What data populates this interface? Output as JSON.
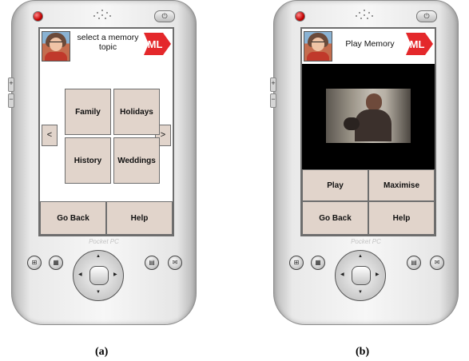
{
  "device_a": {
    "screen_title": "select a memory topic",
    "logo_text": "ML",
    "nav_prev": "<",
    "nav_next": ">",
    "topics": [
      "Family",
      "Holidays",
      "History",
      "Weddings"
    ],
    "buttons": {
      "go_back": "Go Back",
      "help": "Help"
    },
    "brand": "Pocket PC",
    "caption": "(a)"
  },
  "device_b": {
    "screen_title": "Play Memory",
    "logo_text": "ML",
    "buttons": {
      "play": "Play",
      "maximise": "Maximise",
      "go_back": "Go Back",
      "help": "Help"
    },
    "brand": "Pocket PC",
    "caption": "(b)"
  },
  "icons": {
    "power": "power-icon",
    "led": "led-icon",
    "speaker": "speaker-icon",
    "hardware_buttons": [
      "windows-icon",
      "calendar-icon",
      "contacts-icon",
      "mail-icon"
    ],
    "dpad": "dpad-icon"
  },
  "colors": {
    "button_fill": "#e1d4cb",
    "logo_red": "#e4282b",
    "video_background": "#000000"
  }
}
